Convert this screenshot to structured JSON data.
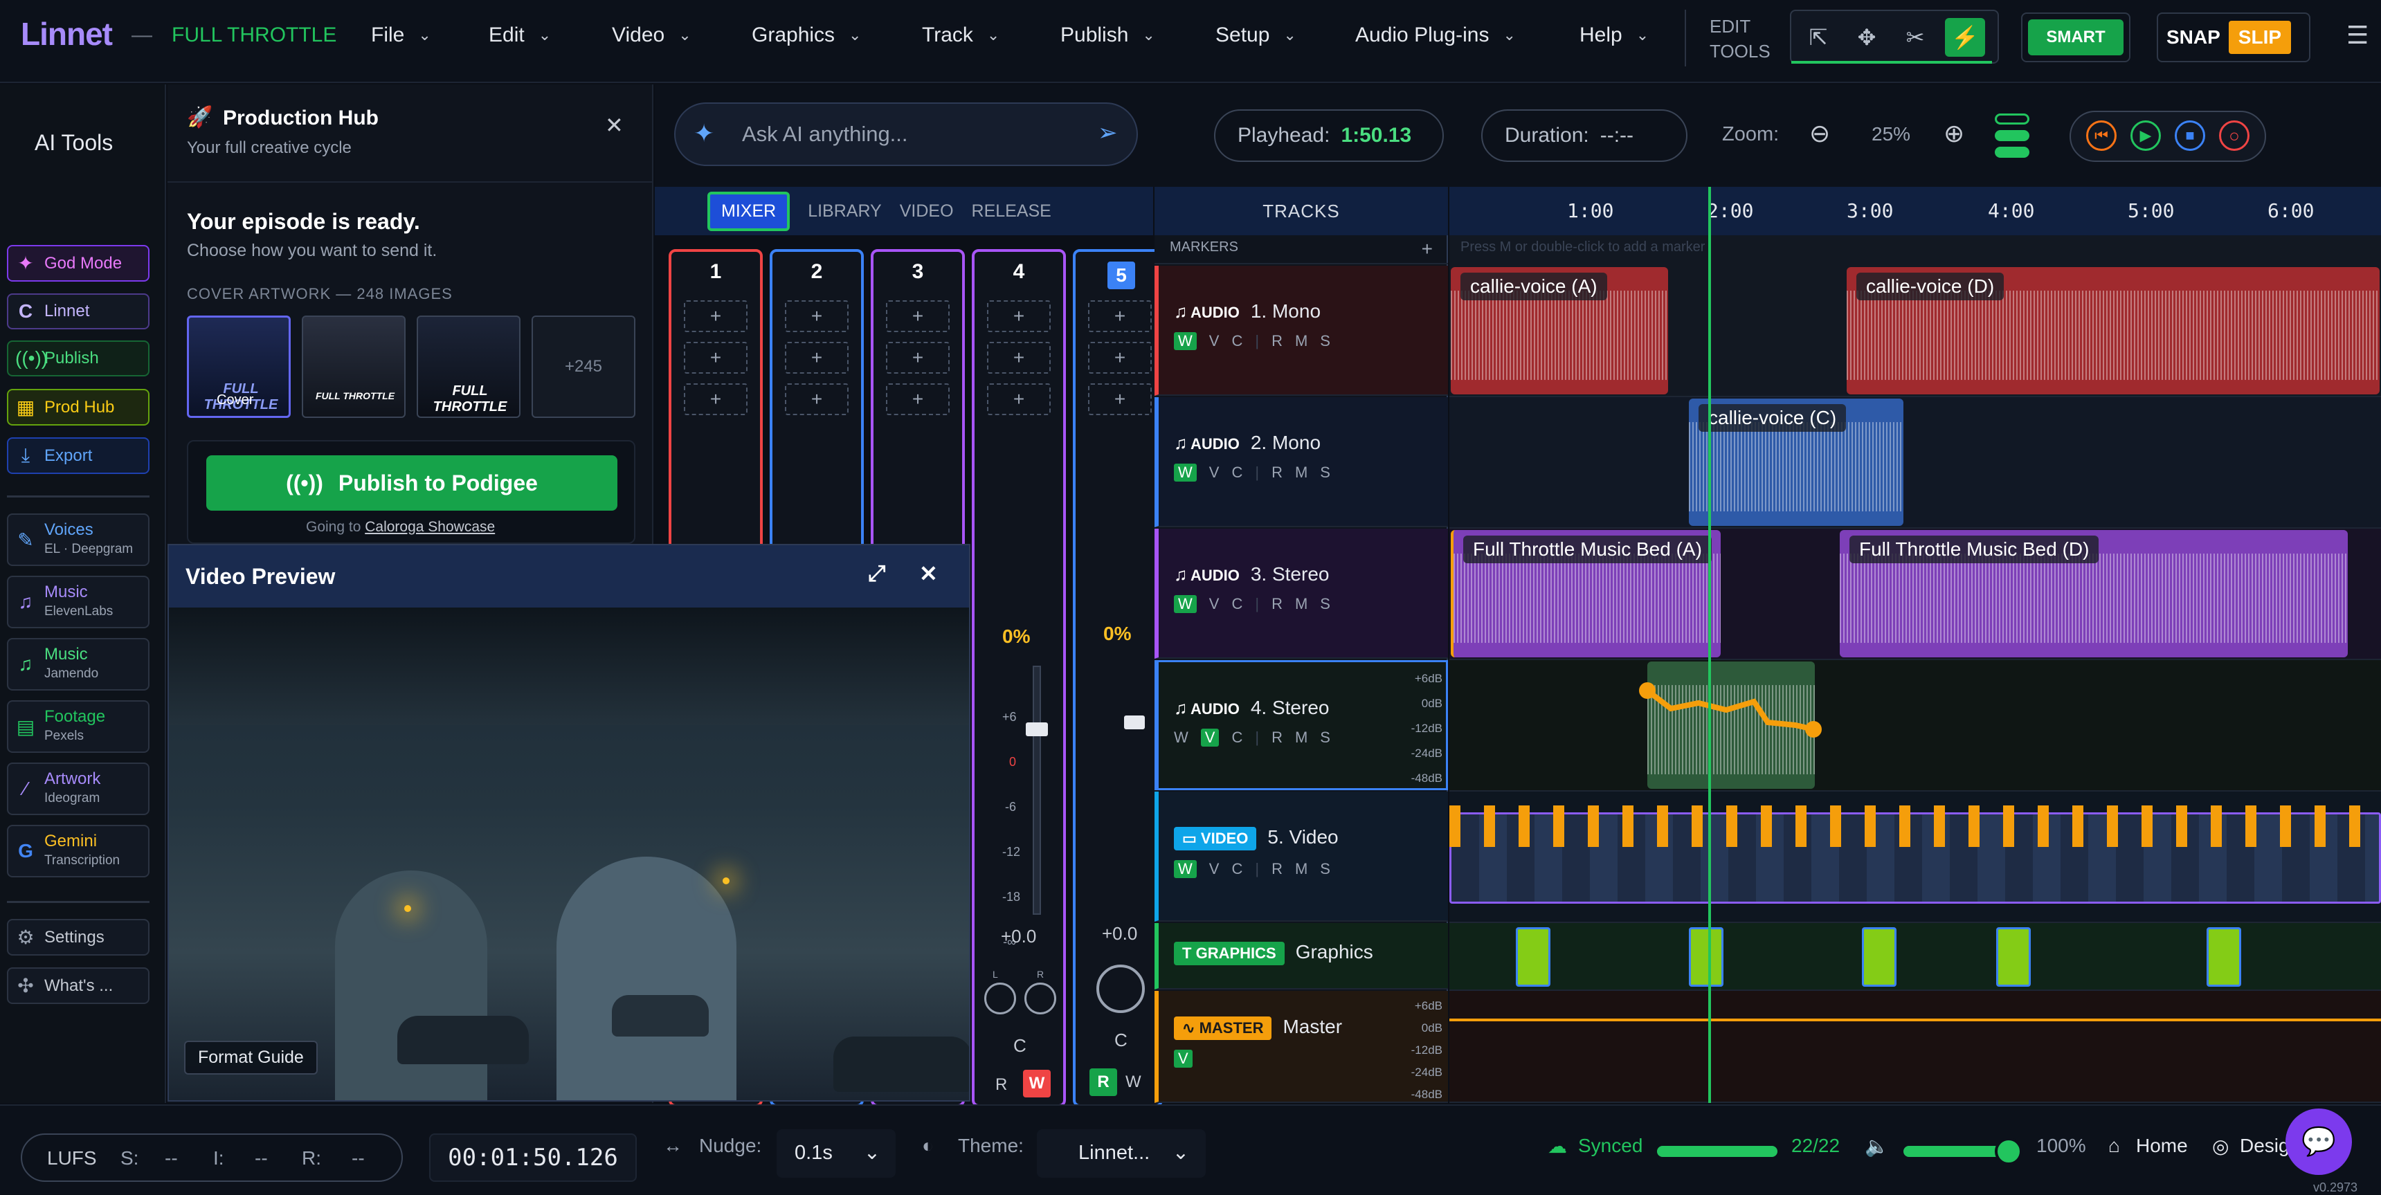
{
  "app": {
    "logo": "Linnet",
    "separator": "—",
    "project": "FULL THROTTLE"
  },
  "menu": [
    "File",
    "Edit",
    "Video",
    "Graphics",
    "Track",
    "Publish",
    "Setup",
    "Audio Plug-ins",
    "Help"
  ],
  "edit_tools": {
    "label1": "EDIT",
    "label2": "TOOLS"
  },
  "smart": "SMART",
  "snap": {
    "snap": "SNAP",
    "slip": "SLIP"
  },
  "sidebar": {
    "title": "AI Tools",
    "items": [
      {
        "label": "God Mode",
        "icon": "sparkle-icon",
        "color": "#e879f9"
      },
      {
        "label": "Linnet",
        "icon": "linnet-icon",
        "color": "#c4b5fd"
      },
      {
        "label": "Publish",
        "icon": "broadcast-icon",
        "color": "#4ade80"
      },
      {
        "label": "Prod Hub",
        "icon": "grid-icon",
        "color": "#facc15"
      },
      {
        "label": "Export",
        "icon": "download-icon",
        "color": "#60a5fa"
      }
    ],
    "tools": [
      {
        "label": "Voices",
        "sub": "EL · Deepgram",
        "color": "#60a5fa"
      },
      {
        "label": "Music",
        "sub": "ElevenLabs",
        "color": "#a78bfa"
      },
      {
        "label": "Music",
        "sub": "Jamendo",
        "color": "#4ade80"
      },
      {
        "label": "Footage",
        "sub": "Pexels",
        "color": "#22c55e"
      },
      {
        "label": "Artwork",
        "sub": "Ideogram",
        "color": "#a78bfa"
      },
      {
        "label": "Gemini",
        "sub": "Transcription",
        "color": "#fbbf24"
      }
    ],
    "bottom": [
      {
        "label": "Settings"
      },
      {
        "label": "What's ..."
      }
    ]
  },
  "hub": {
    "title": "Production Hub",
    "subtitle": "Your full creative cycle",
    "ready": "Your episode is ready.",
    "choose": "Choose how you want to send it.",
    "cover_label": "COVER ARTWORK — 248 IMAGES",
    "cover_tag": "Cover",
    "more": "+245",
    "thumb_texts": [
      "FULL THROTTLE",
      "FULL THROTTLE",
      "FULL THROTTLE"
    ],
    "publish_btn": "Publish to Podigee",
    "going_to": "Going to",
    "destination": "Caloroga Showcase"
  },
  "video_preview": {
    "title": "Video Preview",
    "format_guide": "Format Guide"
  },
  "ask": {
    "placeholder": "Ask AI anything..."
  },
  "playhead": {
    "label": "Playhead:",
    "value": "1:50.13"
  },
  "duration": {
    "label": "Duration:",
    "value": "--:--"
  },
  "zoom": {
    "label": "Zoom:",
    "value": "25%"
  },
  "mixer": {
    "tabs": [
      "MIXER",
      "LIBRARY",
      "VIDEO",
      "RELEASE"
    ],
    "strips": [
      {
        "num": "1",
        "color": "#ef4444"
      },
      {
        "num": "2",
        "color": "#3b82f6"
      },
      {
        "num": "3",
        "color": "#a855f7"
      },
      {
        "num": "4",
        "color": "#a855f7"
      },
      {
        "num": "5",
        "color": "#3b82f6"
      }
    ],
    "level": "0%",
    "gain": "+0.0",
    "pan": "C",
    "scale": [
      "+6",
      "0",
      "-6",
      "-12",
      "-18",
      "-∞"
    ],
    "rec": "R",
    "write": "W",
    "lr": [
      "L",
      "R"
    ]
  },
  "tracks": {
    "header": "TRACKS",
    "markers": "MARKERS",
    "marker_hint": "Press M or double-click to add a marker",
    "list": [
      {
        "type": "AUDIO",
        "name": "1. Mono",
        "color": "#ef4444"
      },
      {
        "type": "AUDIO",
        "name": "2. Mono",
        "color": "#3b82f6"
      },
      {
        "type": "AUDIO",
        "name": "3. Stereo",
        "color": "#a855f7"
      },
      {
        "type": "AUDIO",
        "name": "4. Stereo",
        "color": "#22c55e"
      },
      {
        "type": "VIDEO",
        "name": "5. Video",
        "color": "#0ea5e9"
      },
      {
        "type": "GRAPHICS",
        "name": "Graphics",
        "color": "#22c55e"
      },
      {
        "type": "MASTER",
        "name": "Master",
        "color": "#f59e0b"
      }
    ],
    "wvc": [
      "W",
      "V",
      "C"
    ],
    "rms": [
      "R",
      "M",
      "S"
    ],
    "db": [
      "+6dB",
      "0dB",
      "-12dB",
      "-24dB",
      "-48dB"
    ]
  },
  "ruler": [
    "1:00",
    "2:00",
    "3:00",
    "4:00",
    "5:00",
    "6:00"
  ],
  "clips": [
    {
      "label": "callie-voice (A)"
    },
    {
      "label": "callie-voice (D)"
    },
    {
      "label": "callie-voice (C)"
    },
    {
      "label": "Full Throttle Music Bed (A)"
    },
    {
      "label": "Full Throttle Music Bed (D)"
    }
  ],
  "bottom": {
    "lufs": "LUFS",
    "s": "S:",
    "i": "I:",
    "r": "R:",
    "dash": "--",
    "timecode": "00:01:50.126",
    "nudge_label": "Nudge:",
    "nudge": "0.1s",
    "theme_label": "Theme:",
    "theme": "Linnet...",
    "synced": "Synced",
    "count": "22/22",
    "sync_progress": 1.0,
    "volume": "100%",
    "volume_level": 1.0,
    "home": "Home",
    "design": "Design",
    "version": "v0.2973"
  }
}
